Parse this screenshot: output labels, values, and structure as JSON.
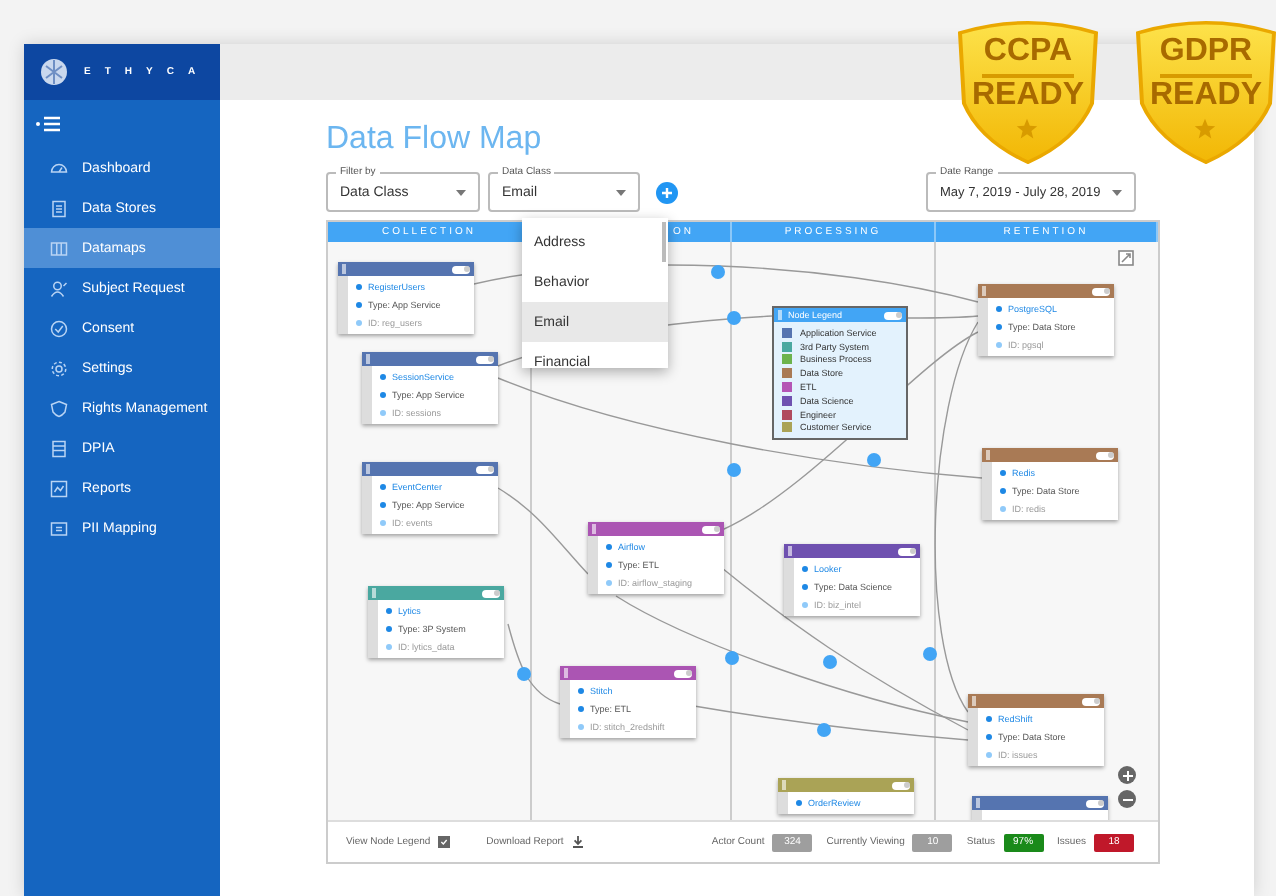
{
  "brand": {
    "name": "ETHYCA"
  },
  "sidebar": {
    "items": [
      {
        "label": "Dashboard",
        "selected": false
      },
      {
        "label": "Data Stores",
        "selected": false
      },
      {
        "label": "Datamaps",
        "selected": true
      },
      {
        "label": "Subject Request",
        "selected": false
      },
      {
        "label": "Consent",
        "selected": false
      },
      {
        "label": "Settings",
        "selected": false
      },
      {
        "label": "Rights Management",
        "selected": false
      },
      {
        "label": "DPIA",
        "selected": false
      },
      {
        "label": "Reports",
        "selected": false
      },
      {
        "label": "PII Mapping",
        "selected": false
      }
    ]
  },
  "page_title": "Data Flow Map",
  "filters": [
    {
      "label": "Filter by",
      "value": "Data Class"
    },
    {
      "label": "Data Class",
      "value": "Email"
    }
  ],
  "date_range": {
    "label": "Date Range",
    "value": "May 7, 2019 - July 28, 2019"
  },
  "dropdown": {
    "options": [
      {
        "label": "Address",
        "selected": false
      },
      {
        "label": "Behavior",
        "selected": false
      },
      {
        "label": "Email",
        "selected": true
      },
      {
        "label": "Financial",
        "selected": false
      }
    ]
  },
  "columns": [
    "COLLECTION",
    "ON",
    "PROCESSING",
    "RETENTION"
  ],
  "nodes": [
    {
      "name": "RegisterUsers",
      "type": "Type: App Service",
      "id": "ID: reg_users",
      "color": "#5574b0"
    },
    {
      "name": "SessionService",
      "type": "Type: App Service",
      "id": "ID: sessions",
      "color": "#5574b0"
    },
    {
      "name": "EventCenter",
      "type": "Type: App Service",
      "id": "ID: events",
      "color": "#5574b0"
    },
    {
      "name": "Lytics",
      "type": "Type: 3P System",
      "id": "ID: lytics_data",
      "color": "#4aa8a0"
    },
    {
      "name": "Airflow",
      "type": "Type: ETL",
      "id": "ID: airflow_staging",
      "color": "#ab55b3"
    },
    {
      "name": "Stitch",
      "type": "Type: ETL",
      "id": "ID: stitch_2redshift",
      "color": "#ab55b3"
    },
    {
      "name": "Looker",
      "type": "Type: Data Science",
      "id": "ID: biz_intel",
      "color": "#6f51b0"
    },
    {
      "name": "PostgreSQL",
      "type": "Type: Data Store",
      "id": "ID: pgsql",
      "color": "#a97a55"
    },
    {
      "name": "Redis",
      "type": "Type: Data Store",
      "id": "ID: redis",
      "color": "#a97a55"
    },
    {
      "name": "RedShift",
      "type": "Type: Data Store",
      "id": "ID: issues",
      "color": "#a97a55"
    },
    {
      "name": "OrderReview",
      "color": "#aaa356"
    },
    {
      "color": "#5574b0"
    }
  ],
  "legend": {
    "title": "Node Legend",
    "items": [
      {
        "label": "Application Service",
        "color": "#5574b0"
      },
      {
        "label": "3rd Party System",
        "color": "#4aa8a0"
      },
      {
        "label": "Business Process",
        "color": "#6db34c"
      },
      {
        "label": "Data Store",
        "color": "#a97a55"
      },
      {
        "label": "ETL",
        "color": "#b455b5"
      },
      {
        "label": "Data Science",
        "color": "#6f51b0"
      },
      {
        "label": "Engineer",
        "color": "#b04a5e"
      },
      {
        "label": "Customer Service",
        "color": "#aaa356"
      }
    ]
  },
  "footer": {
    "view_node_legend": {
      "label": "View Node Legend",
      "checked": true
    },
    "download_report": {
      "label": "Download Report"
    },
    "stats": [
      {
        "label": "Actor Count",
        "value": "324",
        "color": "#9e9e9e"
      },
      {
        "label": "Currently Viewing",
        "value": "10",
        "color": "#9e9e9e"
      },
      {
        "label": "Status",
        "value": "97%",
        "color": "#1a8a1a"
      },
      {
        "label": "Issues",
        "value": "18",
        "color": "#c0182a"
      }
    ]
  },
  "badges": [
    {
      "title": "CCPA",
      "subtitle": "READY"
    },
    {
      "title": "GDPR",
      "subtitle": "READY"
    }
  ]
}
